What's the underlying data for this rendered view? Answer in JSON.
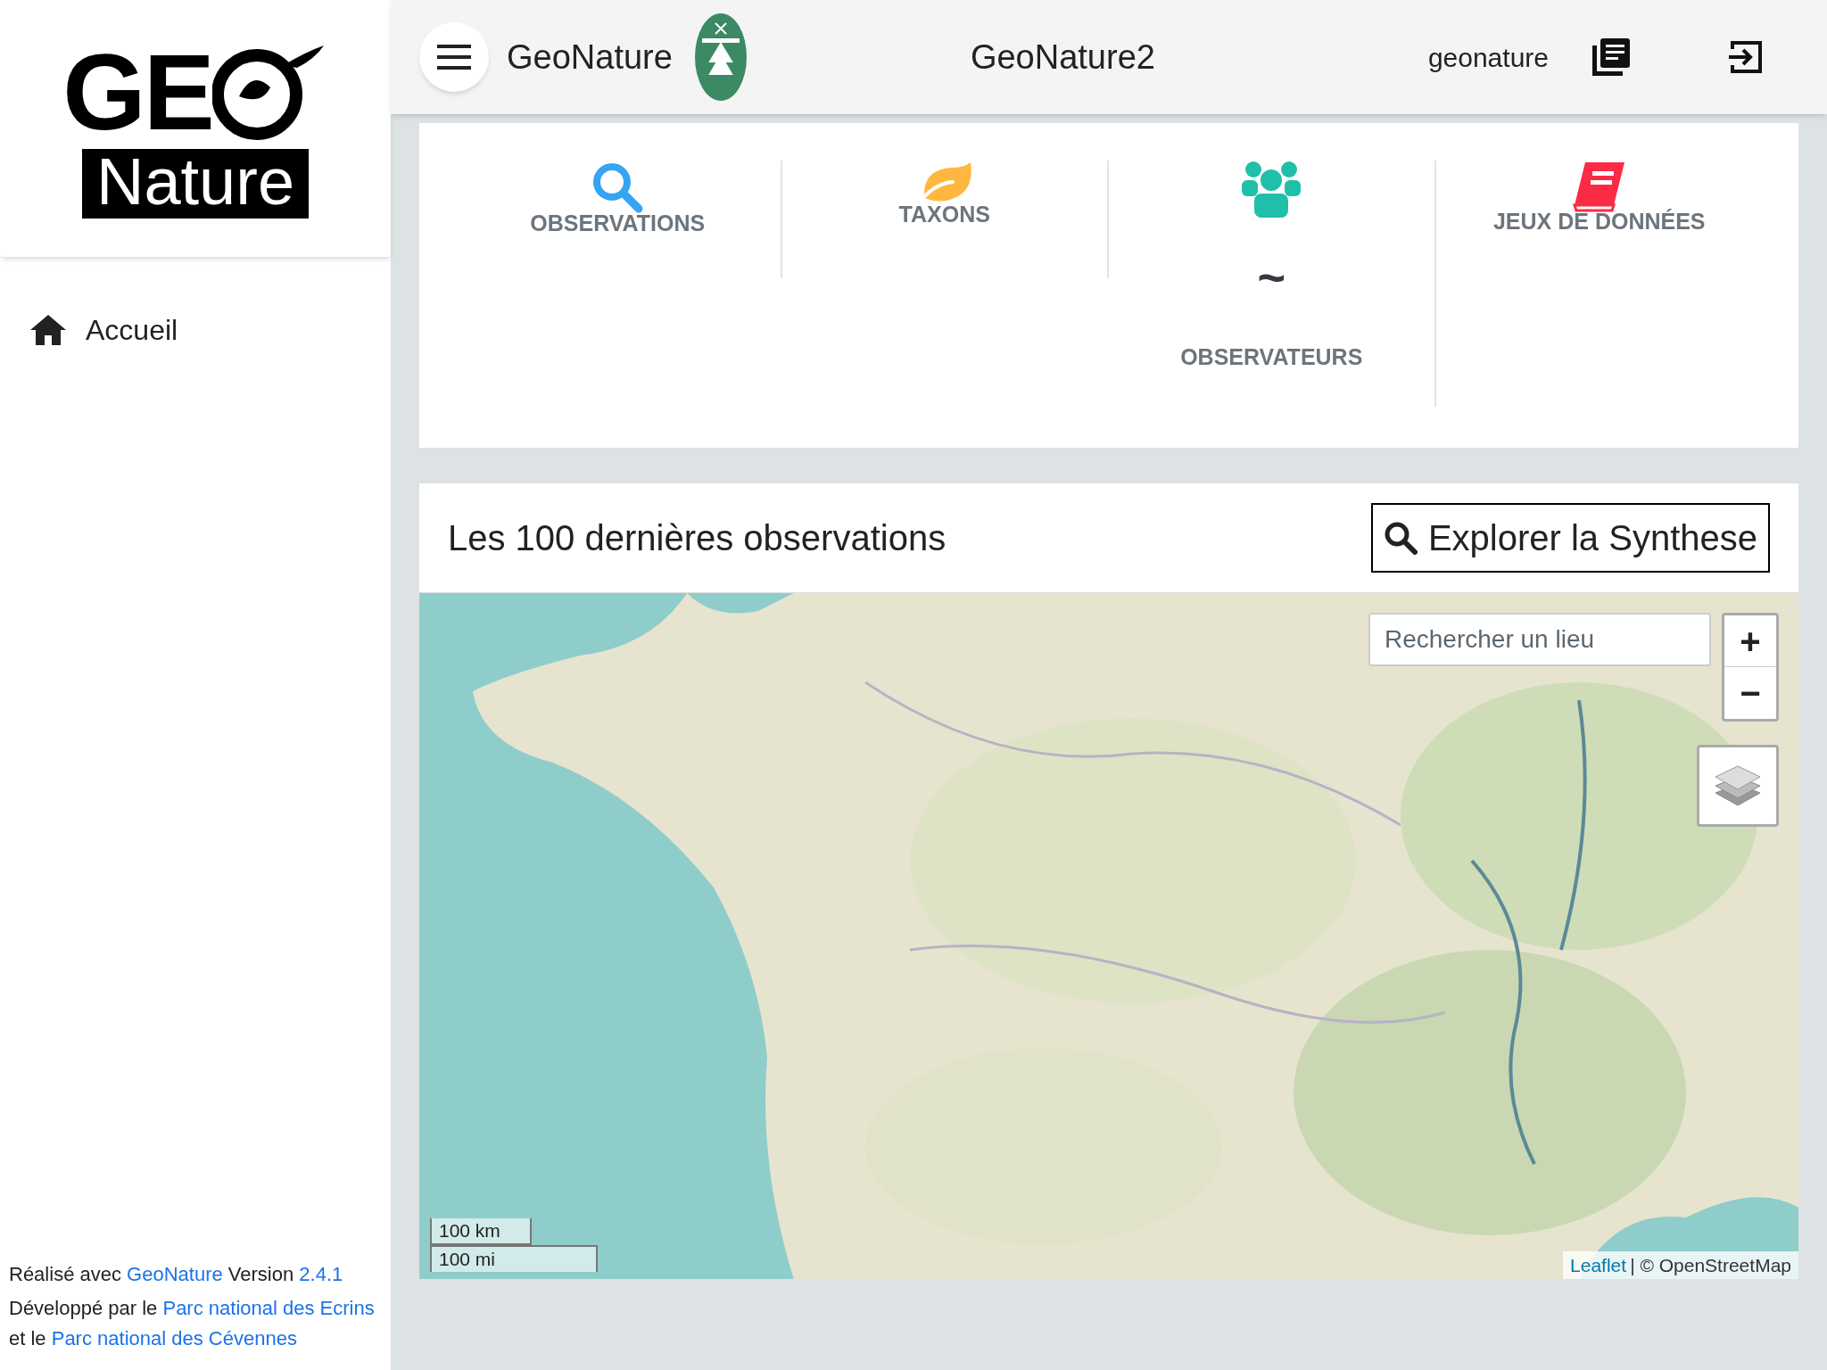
{
  "logo": {
    "top": "GE",
    "bottom": "Nature"
  },
  "sidebar": {
    "items": [
      {
        "label": "Accueil",
        "selected": false
      }
    ]
  },
  "footer": [
    {
      "parts": [
        {
          "text": "Réalisé avec "
        },
        {
          "text": "GeoNature",
          "link": true
        },
        {
          "text": " Version "
        },
        {
          "text": "2.4.1",
          "link": true
        }
      ]
    },
    {
      "parts": [
        {
          "text": "Développé par le "
        },
        {
          "text": "Parc national des Ecrins",
          "link": true
        },
        {
          "text": " et le "
        },
        {
          "text": "Parc national des Cévennes",
          "link": true
        }
      ]
    }
  ],
  "top_bar": {
    "app_name": "GeoNature",
    "title": "GeoNature2",
    "user": "geonature"
  },
  "stats": [
    {
      "kind": "observations",
      "label": "OBSERVATIONS"
    },
    {
      "kind": "taxons",
      "label": "TAXONS"
    },
    {
      "kind": "observers",
      "label": "OBSERVATEURS",
      "value": "~"
    },
    {
      "kind": "datasets",
      "label": "JEUX DE DONNÉES"
    }
  ],
  "map_card": {
    "title": "Les 100 dernières observations",
    "button": "Explorer la Synthese",
    "map": {
      "search": {
        "placeholder": "Rechercher un lieu"
      },
      "zoom_in": "+",
      "zoom_out": "−",
      "scale": [
        "100 km",
        "100 mi"
      ],
      "attribution": {
        "link": "Leaflet",
        "text": "| © OpenStreetMap"
      }
    }
  }
}
